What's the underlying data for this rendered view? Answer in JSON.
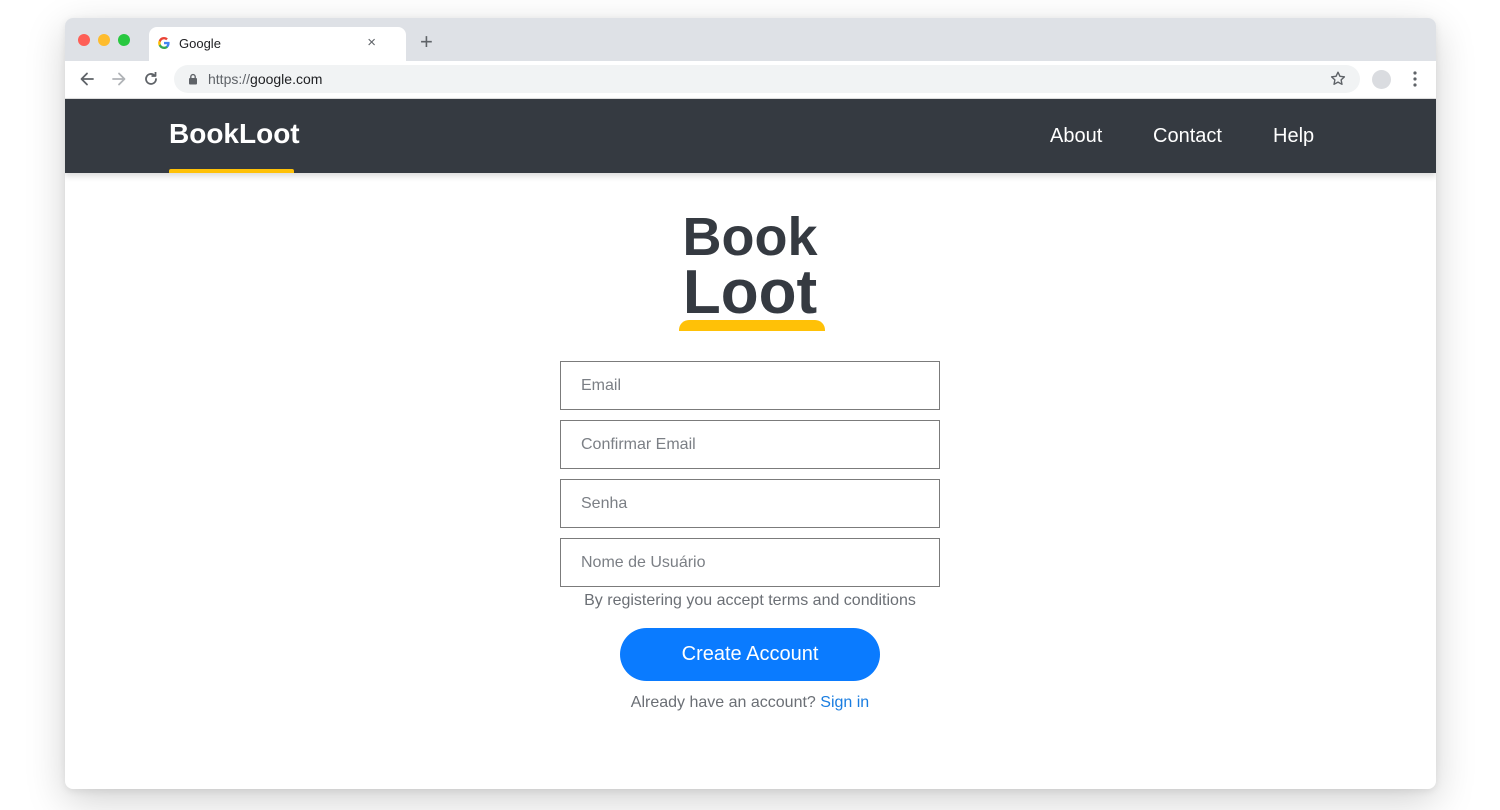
{
  "browser": {
    "tab_title": "Google",
    "tab_close": "×",
    "new_tab": "+",
    "url_scheme": "https://",
    "url_host": "google.com"
  },
  "header": {
    "brand": "BookLoot",
    "nav": {
      "about": "About",
      "contact": "Contact",
      "help": "Help"
    }
  },
  "logo": {
    "line1": "Book",
    "line2": "Loot"
  },
  "form": {
    "email_placeholder": "Email",
    "confirm_email_placeholder": "Confirmar Email",
    "password_placeholder": "Senha",
    "username_placeholder": "Nome de Usuário",
    "terms": "By registering you accept terms and conditions",
    "submit_label": "Create Account",
    "signin_prompt": "Already have an account?",
    "signin_link": "Sign in"
  },
  "colors": {
    "header_bg": "#353a41",
    "accent": "#ffc107",
    "button": "#0a7bff",
    "link": "#1a7de0"
  },
  "icons": {
    "favicon": "google-g-icon",
    "back": "arrow-left-icon",
    "forward": "arrow-right-icon",
    "reload": "reload-icon",
    "lock": "lock-icon",
    "bookmark": "star-icon",
    "profile": "avatar",
    "menu": "kebab-menu-icon"
  }
}
